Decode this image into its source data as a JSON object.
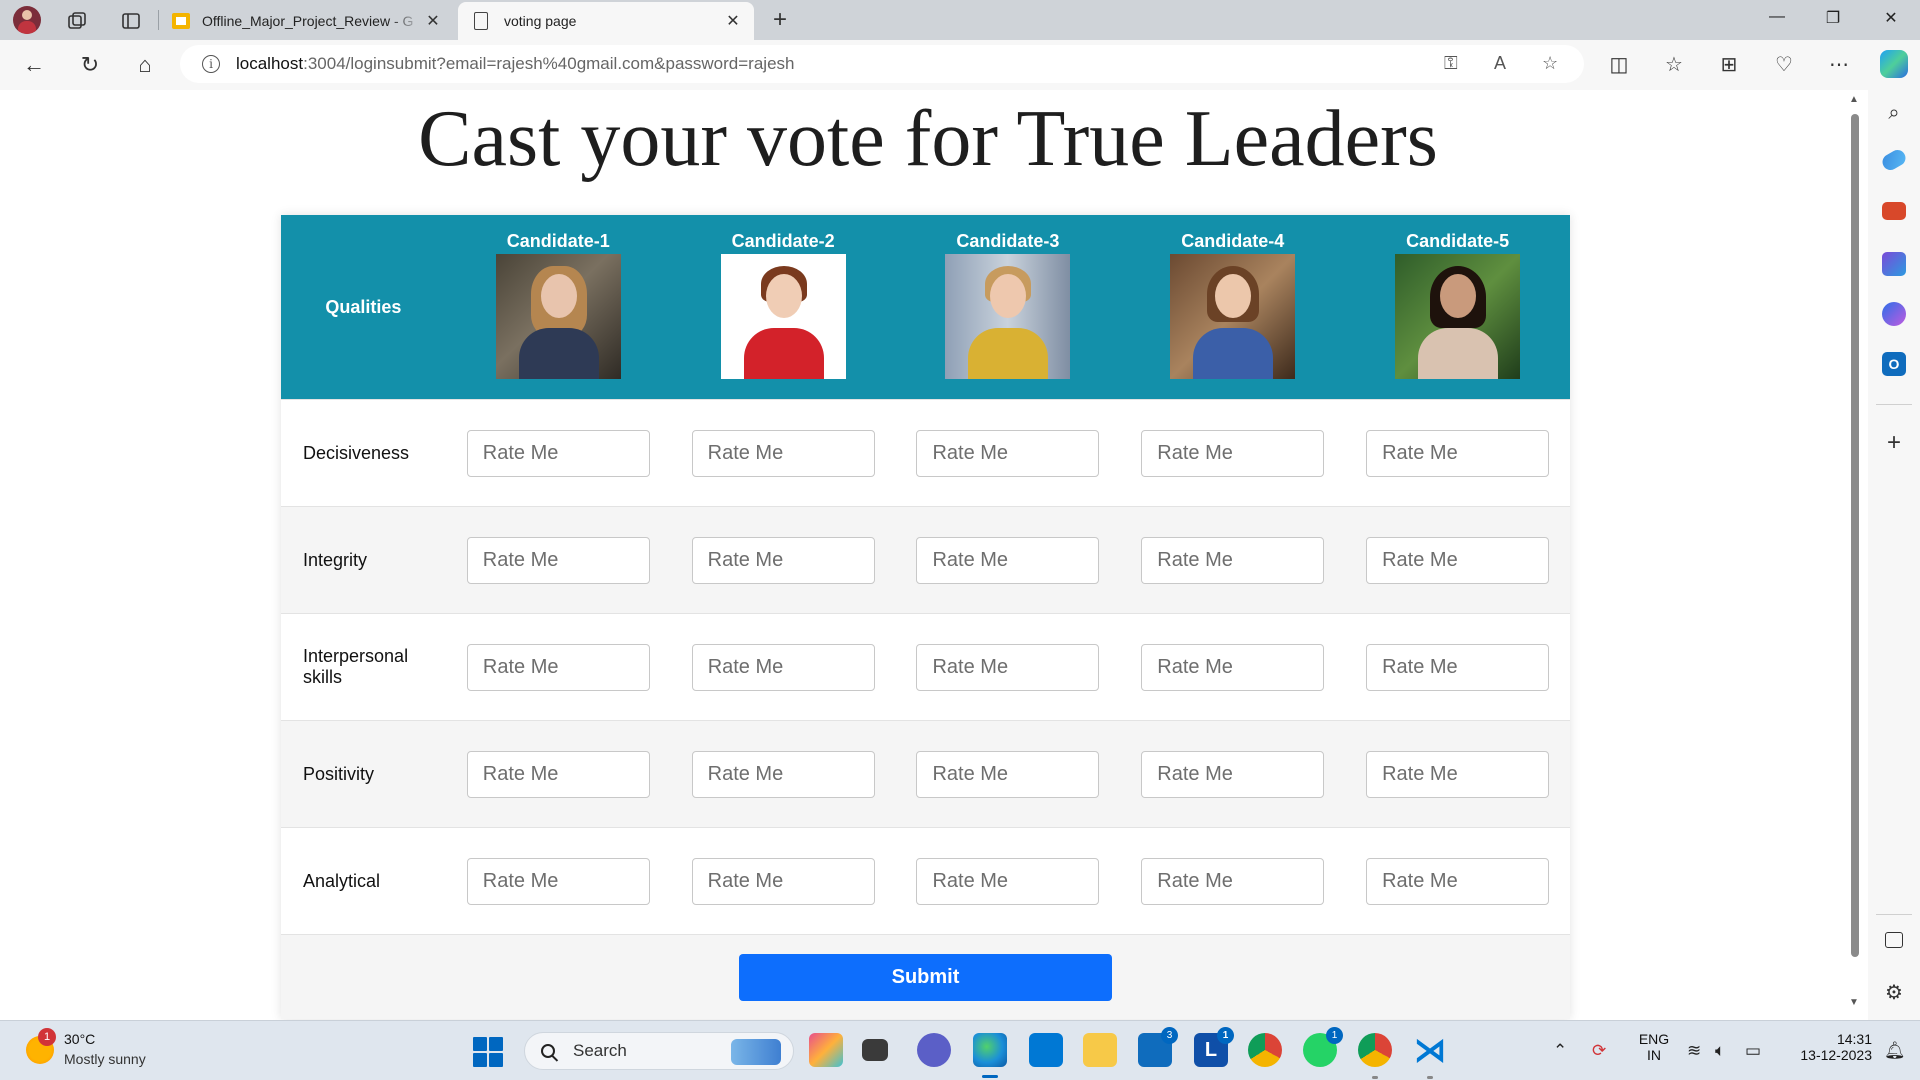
{
  "browser": {
    "tabs": [
      {
        "title": "Offline_Major_Project_Review - G",
        "active": false
      },
      {
        "title": "voting page",
        "active": true
      }
    ],
    "url_host": "localhost",
    "url_rest": ":3004/loginsubmit?email=rajesh%40gmail.com&password=rajesh",
    "new_tab_glyph": "+",
    "close_glyph": "✕"
  },
  "page": {
    "title": "Cast your vote for True Leaders",
    "qualities_header": "Qualities",
    "candidates": [
      {
        "name": "Candidate-1"
      },
      {
        "name": "Candidate-2"
      },
      {
        "name": "Candidate-3"
      },
      {
        "name": "Candidate-4"
      },
      {
        "name": "Candidate-5"
      }
    ],
    "qualities": [
      {
        "label": "Decisiveness"
      },
      {
        "label": "Integrity"
      },
      {
        "label": "Interpersonal skills"
      },
      {
        "label": "Positivity"
      },
      {
        "label": "Analytical"
      }
    ],
    "rate_placeholder": "Rate Me",
    "submit_label": "Submit",
    "header_color": "#1390aa",
    "submit_color": "#0d6efd"
  },
  "taskbar": {
    "weather_temp": "30°C",
    "weather_condition": "Mostly sunny",
    "weather_badge": "1",
    "search_label": "Search",
    "language_line1": "ENG",
    "language_line2": "IN",
    "time": "14:31",
    "date": "13-12-2023",
    "badges": {
      "mail": "3",
      "lync": "1",
      "whatsapp": "1"
    }
  }
}
